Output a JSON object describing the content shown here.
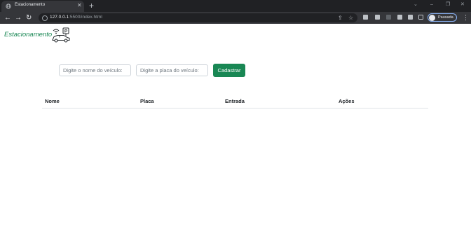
{
  "browser": {
    "tab_title": "Estacionamento",
    "tab_close": "✕",
    "new_tab": "+",
    "url_host": "127.0.0.1",
    "url_rest": ":5500/index.html",
    "profile_label": "Pausada",
    "window_controls": {
      "minimize": "–",
      "maximize": "❐",
      "close": "✕"
    },
    "nav": {
      "back": "←",
      "forward": "→",
      "reload": "↻"
    },
    "omni_icons": {
      "share": "⇪",
      "star": "☆"
    },
    "menu": "⋮"
  },
  "header": {
    "brand": "Estacionamento",
    "logo_icon": "parking-car-wifi-icon"
  },
  "form": {
    "name_placeholder": "Digite o nome do veículo:",
    "name_value": "",
    "plate_placeholder": "Digite a placa do veículo:",
    "plate_value": "",
    "submit_label": "Cadastrar"
  },
  "table": {
    "columns": [
      "Nome",
      "Placa",
      "Entrada",
      "Ações"
    ],
    "rows": []
  },
  "colors": {
    "accent": "#198754",
    "chrome_dark": "#202124",
    "chrome_toolbar": "#35363a"
  }
}
